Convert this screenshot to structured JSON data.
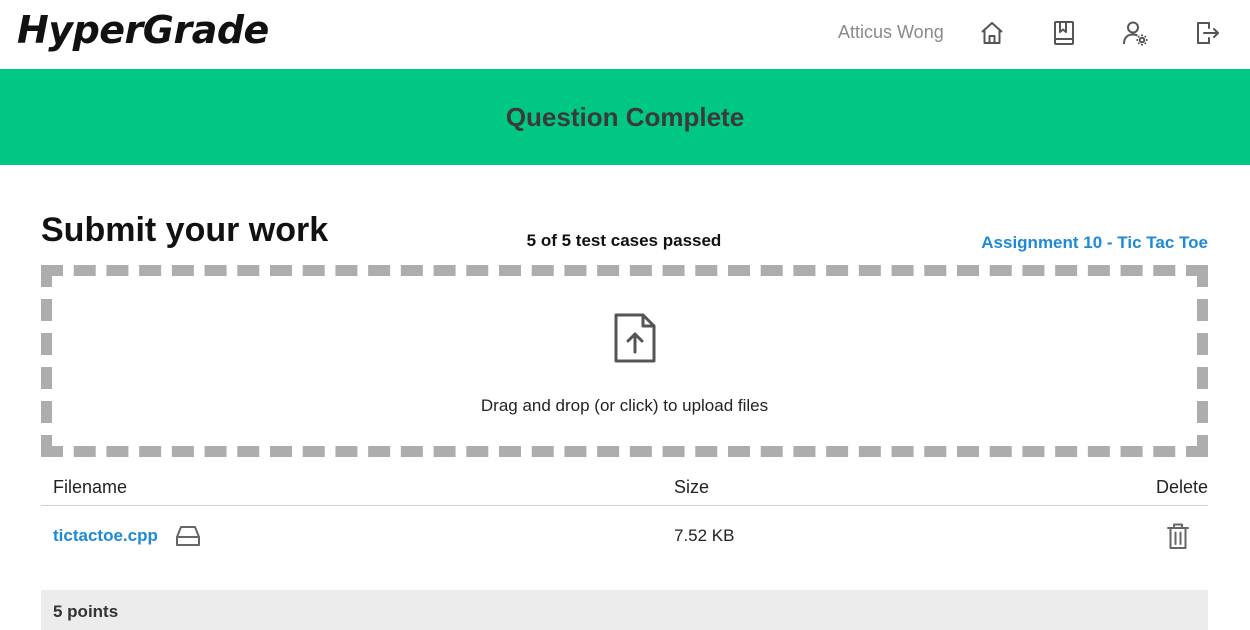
{
  "navbar": {
    "brand": "HyperGrade",
    "user_name": "Atticus Wong",
    "icons": [
      "home-icon",
      "book-icon",
      "user-settings-icon",
      "logout-icon"
    ]
  },
  "banner": {
    "title": "Question Complete",
    "color": "#00c884"
  },
  "submit": {
    "title": "Submit your work",
    "tests_status": "5 of 5 test cases passed",
    "assignment_link": "Assignment 10 - Tic Tac Toe"
  },
  "dropzone": {
    "text": "Drag and drop (or click) to upload files",
    "icon": "file-upload-icon"
  },
  "files_table": {
    "headers": {
      "filename": "Filename",
      "size": "Size",
      "delete": "Delete"
    },
    "rows": [
      {
        "filename": "tictactoe.cpp",
        "size": "7.52 KB"
      }
    ]
  },
  "points": {
    "text": "5 points"
  },
  "colors": {
    "accent_link": "#1e8ad6",
    "banner_green": "#00c884",
    "dropzone_border": "#adadad"
  }
}
